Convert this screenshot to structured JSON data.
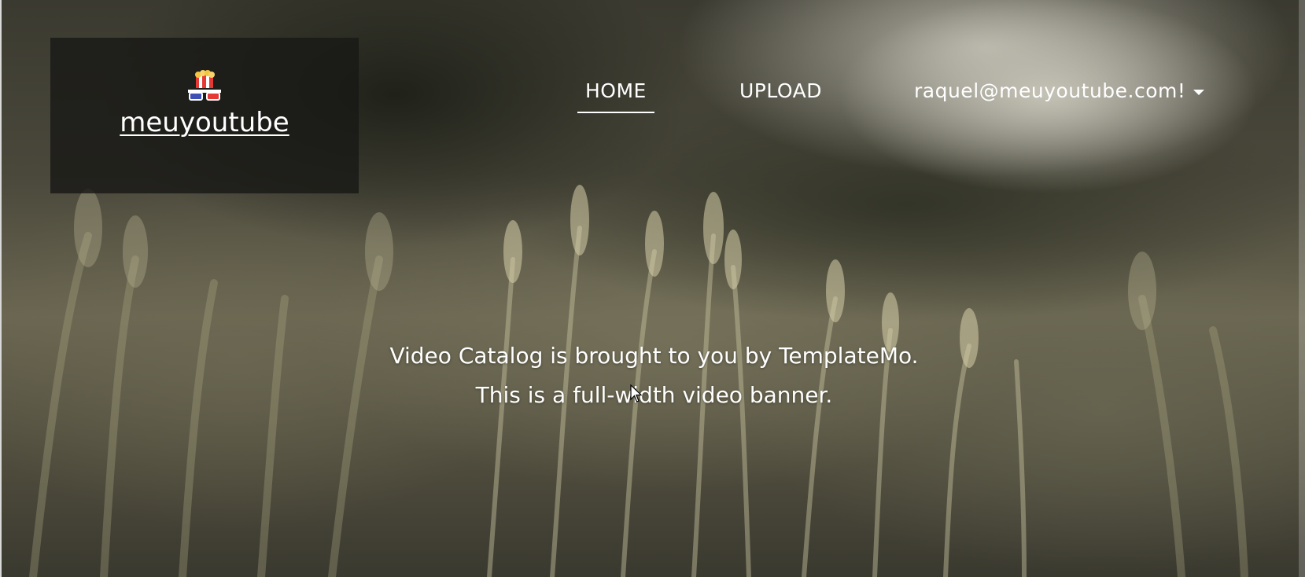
{
  "brand": {
    "logo_icon": "popcorn-3d-glasses-icon",
    "name": "meuyoutube"
  },
  "nav": {
    "items": [
      {
        "label": "HOME",
        "active": true
      },
      {
        "label": "UPLOAD",
        "active": false
      }
    ],
    "user": {
      "label": "raquel@meuyoutube.com!",
      "dropdown_icon": "caret-down-icon"
    }
  },
  "banner": {
    "line1": "Video Catalog is brought to you by TemplateMo.",
    "line2": "This is a full-width video banner."
  },
  "colors": {
    "text": "#ffffff",
    "brand_box": "#181816"
  }
}
